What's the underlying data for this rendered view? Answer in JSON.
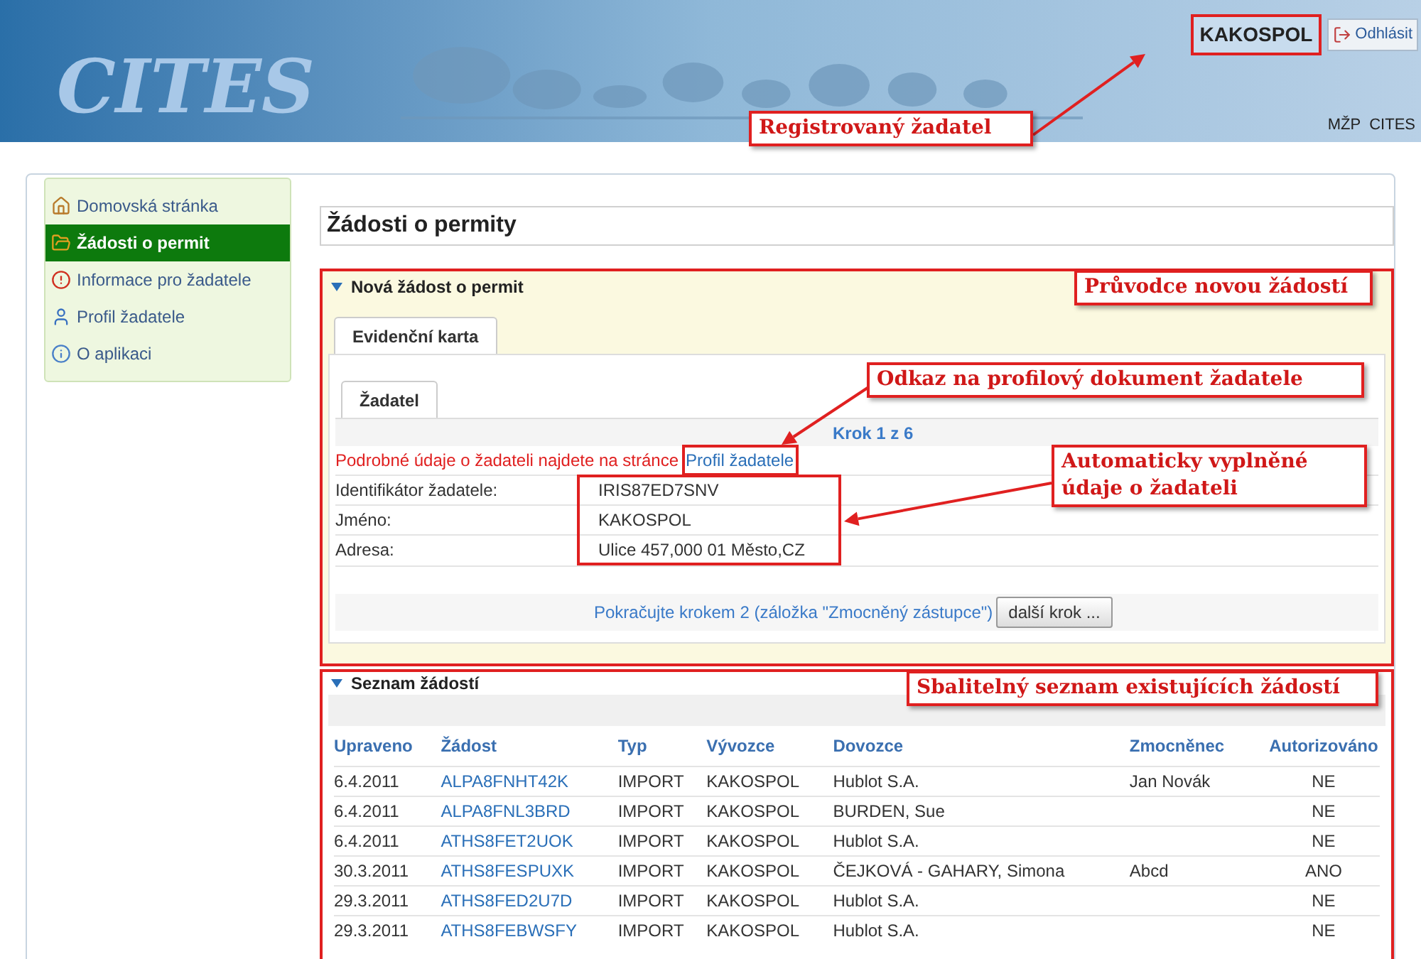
{
  "header": {
    "logo": "CITES",
    "user": "KAKOSPOL",
    "logout": "Odhlásit",
    "nav": [
      "MŽP",
      "CITES"
    ]
  },
  "sidebar": {
    "items": [
      {
        "label": "Domovská stránka",
        "selected": false
      },
      {
        "label": "Žádosti o permit",
        "selected": true
      },
      {
        "label": "Informace pro žadatele",
        "selected": false
      },
      {
        "label": "Profil žadatele",
        "selected": false
      },
      {
        "label": "O aplikaci",
        "selected": false
      }
    ]
  },
  "page_title": "Žádosti o permity",
  "new_request": {
    "title": "Nová žádost o permit",
    "expanded": true,
    "outer_tabs": [
      {
        "label": "Evidenční karta",
        "selected": true
      }
    ],
    "inner_tabs": [
      {
        "label": "Žadatel",
        "selected": true
      }
    ],
    "step": "Krok 1 z 6",
    "notice": "Podrobné údaje o žadateli najdete na stránce",
    "notice_link": "Profil žadatele",
    "fields": [
      {
        "label": "Identifikátor žadatele:",
        "value": "IRIS87ED7SNV"
      },
      {
        "label": "Jméno:",
        "value": "KAKOSPOL"
      },
      {
        "label": "Adresa:",
        "value": "Ulice 457,000 01 Město,CZ"
      }
    ],
    "continue_text": "Pokračujte krokem 2 (záložka \"Zmocněný zástupce\")",
    "next_button": "další krok ..."
  },
  "request_list": {
    "title": "Seznam žádostí",
    "expanded": true,
    "columns": [
      "Upraveno",
      "Žádost",
      "Typ",
      "Vývozce",
      "Dovozce",
      "Zmocněnec",
      "Autorizováno"
    ],
    "rows": [
      [
        "6.4.2011",
        "ALPA8FNHT42K",
        "IMPORT",
        "KAKOSPOL",
        "Hublot S.A.",
        "Jan Novák",
        "NE"
      ],
      [
        "6.4.2011",
        "ALPA8FNL3BRD",
        "IMPORT",
        "KAKOSPOL",
        "BURDEN, Sue",
        "",
        "NE"
      ],
      [
        "6.4.2011",
        "ATHS8FET2UOK",
        "IMPORT",
        "KAKOSPOL",
        "Hublot S.A.",
        "",
        "NE"
      ],
      [
        "30.3.2011",
        "ATHS8FESPUXK",
        "IMPORT",
        "KAKOSPOL",
        "ČEJKOVÁ - GAHARY, Simona",
        "Abcd",
        "ANO"
      ],
      [
        "29.3.2011",
        "ATHS8FED2U7D",
        "IMPORT",
        "KAKOSPOL",
        "Hublot S.A.",
        "",
        "NE"
      ],
      [
        "29.3.2011",
        "ATHS8FEBWSFY",
        "IMPORT",
        "KAKOSPOL",
        "Hublot S.A.",
        "",
        "NE"
      ]
    ]
  },
  "annotations": [
    "Registrovaný žadatel",
    "Průvodce novou žádostí",
    "Odkaz na profilový dokument žadatele",
    "Automaticky vyplněné údaje o žadateli",
    "Sbalitelný seznam existujících žádostí"
  ]
}
